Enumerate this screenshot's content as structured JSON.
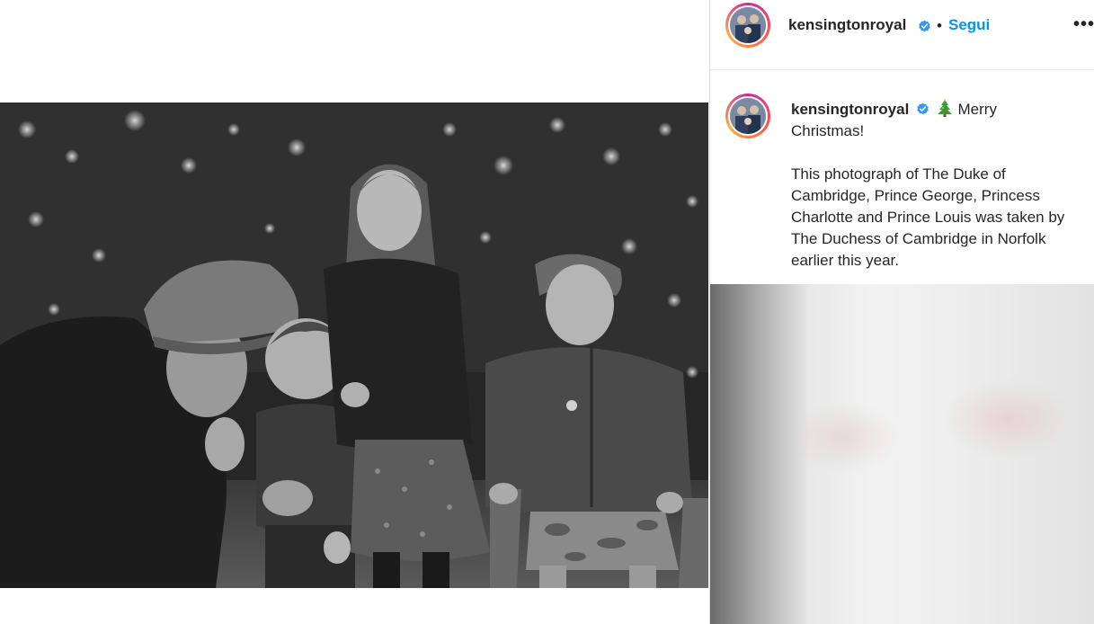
{
  "post": {
    "username": "kensingtonroyal",
    "separator": "•",
    "follow_label": "Segui",
    "more_label": "•••"
  },
  "caption": {
    "username": "kensingtonroyal",
    "emoji": "christmas-tree-icon",
    "greeting": "Merry Christmas!",
    "body": "This photograph of The Duke of Cambridge, Prince George, Princess Charlotte and Prince Louis was taken by The Duchess of Cambridge in Norfolk earlier this year."
  },
  "icons": {
    "verified": "verified-badge-icon",
    "more": "more-options-icon"
  },
  "colors": {
    "link_blue": "#0095f6",
    "verified_blue": "#3897f0",
    "text": "#262626",
    "border": "#dbdbdb"
  }
}
